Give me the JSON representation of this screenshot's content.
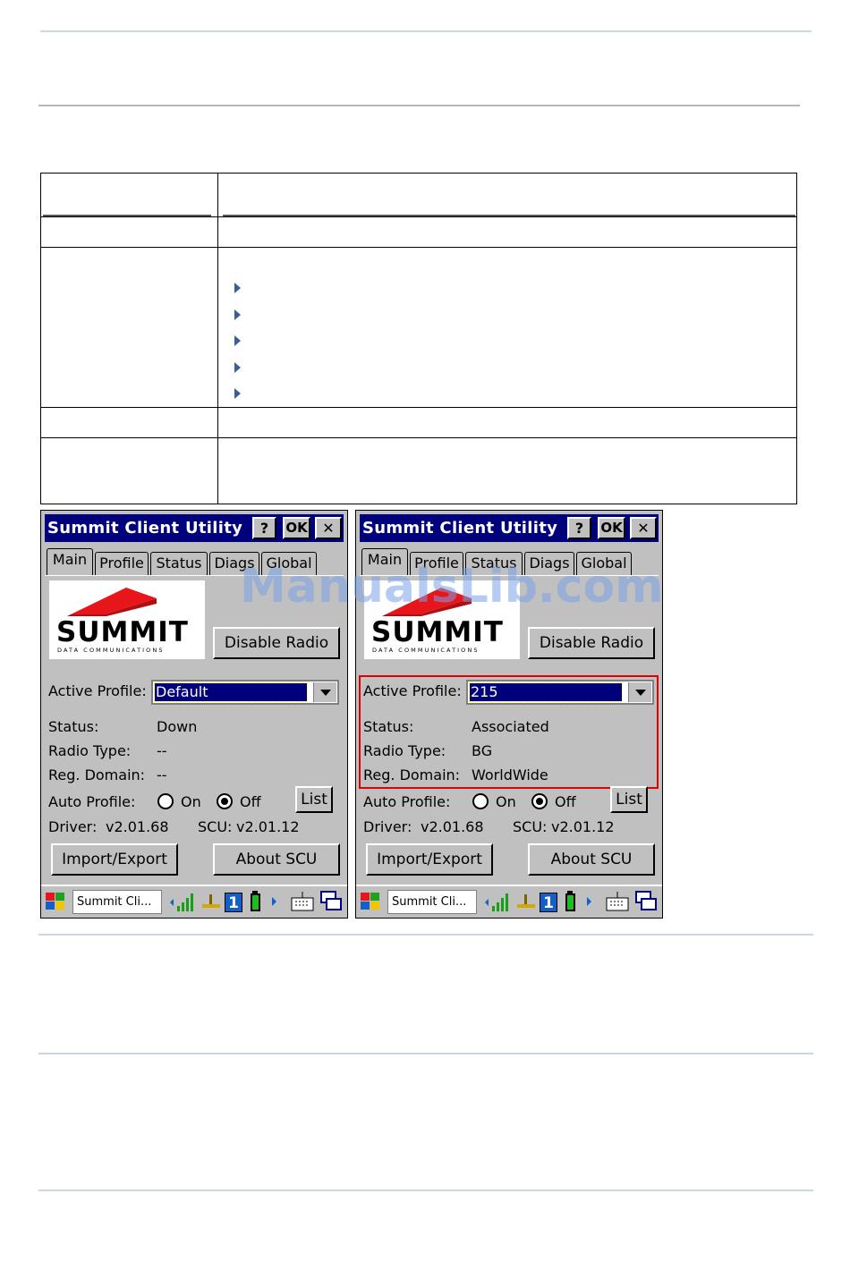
{
  "devices": [
    {
      "title": "Summit Client Utility",
      "help_label": "?",
      "ok_label": "OK",
      "close_label": "✕",
      "tabs": [
        "Main",
        "Profile",
        "Status",
        "Diags",
        "Global"
      ],
      "logo_text": "SUMMIT",
      "logo_sub": "DATA COMMUNICATIONS",
      "disable_radio": "Disable Radio",
      "active_profile_label": "Active Profile:",
      "active_profile_value": "Default",
      "status_label": "Status:",
      "status_value": "Down",
      "radio_type_label": "Radio Type:",
      "radio_type_value": "--",
      "reg_domain_label": "Reg. Domain:",
      "reg_domain_value": "--",
      "auto_profile_label": "Auto Profile:",
      "on_label": "On",
      "off_label": "Off",
      "auto_profile_selected": "Off",
      "list_label": "List",
      "driver_label": "Driver:",
      "driver_value": "v2.01.68",
      "scu_label": "SCU:",
      "scu_value": "v2.01.12",
      "import_export": "Import/Export",
      "about": "About SCU",
      "taskbar_task": "Summit Cli...",
      "taskbar_badge": "1"
    },
    {
      "title": "Summit Client Utility",
      "help_label": "?",
      "ok_label": "OK",
      "close_label": "✕",
      "tabs": [
        "Main",
        "Profile",
        "Status",
        "Diags",
        "Global"
      ],
      "logo_text": "SUMMIT",
      "logo_sub": "DATA COMMUNICATIONS",
      "disable_radio": "Disable Radio",
      "active_profile_label": "Active Profile:",
      "active_profile_value": "215",
      "status_label": "Status:",
      "status_value": "Associated",
      "radio_type_label": "Radio Type:",
      "radio_type_value": "BG",
      "reg_domain_label": "Reg. Domain:",
      "reg_domain_value": "WorldWide",
      "auto_profile_label": "Auto Profile:",
      "on_label": "On",
      "off_label": "Off",
      "auto_profile_selected": "Off",
      "list_label": "List",
      "driver_label": "Driver:",
      "driver_value": "v2.01.68",
      "scu_label": "SCU:",
      "scu_value": "v2.01.12",
      "import_export": "Import/Export",
      "about": "About SCU",
      "taskbar_task": "Summit Cli...",
      "taskbar_badge": "1"
    }
  ],
  "watermark": "ManualsLib.com",
  "colors": {
    "title_bar": "#00007c",
    "dialog_gray": "#c0c0c0",
    "highlight_box": "#e00000",
    "bullet": "#3a5f96",
    "rule": "#c9d6e3",
    "logo_red": "#e8151b"
  }
}
